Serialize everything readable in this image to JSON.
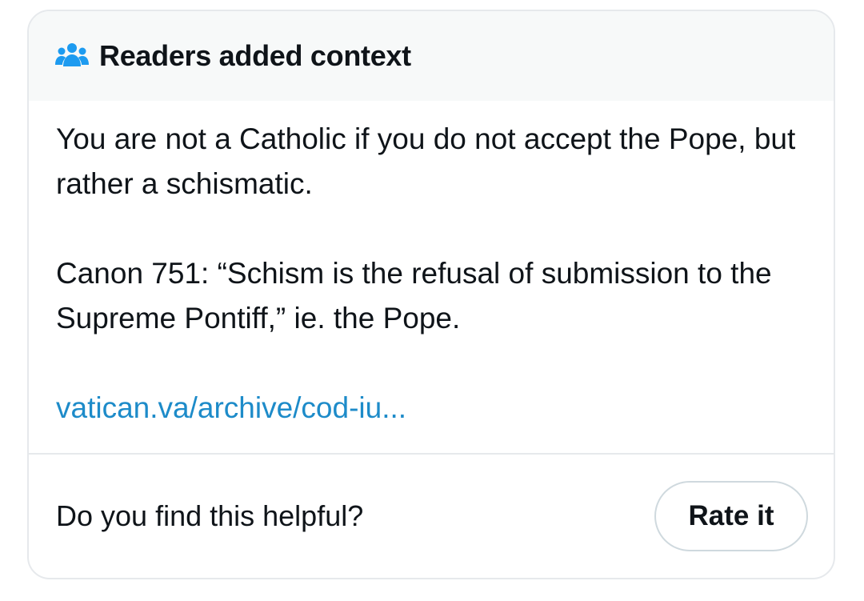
{
  "header": {
    "icon": "people-icon",
    "title": "Readers added context"
  },
  "note": {
    "paragraph1": "You are not a Catholic if you do not accept the Pope, but rather a schismatic.",
    "paragraph2": "Canon 751: “Schism is the refusal of submission to the Supreme Pontiff,” ie. the Pope.",
    "link_text": "vatican.va/archive/cod-iu..."
  },
  "footer": {
    "question": "Do you find this helpful?",
    "rate_label": "Rate it"
  },
  "colors": {
    "accent_link": "#1d8bc9",
    "icon": "#1d9bf0",
    "header_bg": "#f7f9f9",
    "border": "#e6e9ec",
    "text": "#0f1419"
  }
}
